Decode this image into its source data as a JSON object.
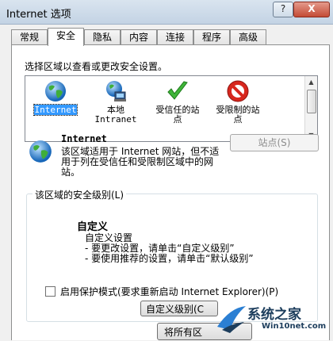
{
  "window": {
    "title": "Internet 选项",
    "help_label": "?",
    "close_label": "X"
  },
  "tabs": [
    {
      "label": "常规"
    },
    {
      "label": "安全"
    },
    {
      "label": "隐私"
    },
    {
      "label": "内容"
    },
    {
      "label": "连接"
    },
    {
      "label": "程序"
    },
    {
      "label": "高级"
    }
  ],
  "active_tab": "安全",
  "security": {
    "prompt": "选择区域以查看或更改安全设置。",
    "zones": [
      {
        "label_line1": "Internet",
        "label_line2": "",
        "icon": "globe-icon"
      },
      {
        "label_line1": "本地",
        "label_line2": "Intranet",
        "icon": "intranet-icon"
      },
      {
        "label_line1": "受信任的站",
        "label_line2": "点",
        "icon": "check-icon"
      },
      {
        "label_line1": "受限制的站",
        "label_line2": "点",
        "icon": "restricted-icon"
      }
    ],
    "selected_zone": "Internet",
    "zone_name": "Internet",
    "zone_desc": "该区域适用于 Internet 网站，但不适用于列在受信任和受限制区域中的网站。",
    "sites_button": "站点(S)",
    "level_group_title": "该区域的安全级别(L)",
    "level_name": "自定义",
    "level_desc_line1": "自定义设置",
    "level_desc_line2": "- 要更改设置，请单击“自定义级别”",
    "level_desc_line3": "- 要使用推荐的设置，请单击“默认级别”",
    "protected_mode_label": "启用保护模式(要求重新启动 Internet Explorer)(P)",
    "protected_mode_checked": false,
    "custom_level_button": "自定义级别(C",
    "reset_button": "将所有区"
  },
  "watermark": {
    "title": "系统之家",
    "url": "Win10net.com"
  },
  "colors": {
    "selection": "#3399ff",
    "close_button": "#c44b35"
  }
}
